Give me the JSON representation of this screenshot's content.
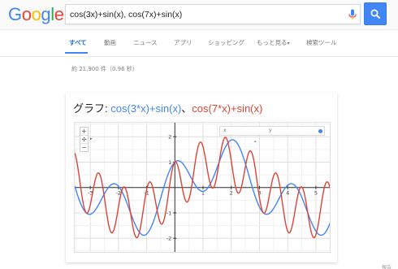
{
  "logo": {
    "letters": [
      "G",
      "o",
      "o",
      "g",
      "l",
      "e"
    ],
    "colors": [
      "#4285f4",
      "#ea4335",
      "#fbbc05",
      "#4285f4",
      "#34a853",
      "#ea4335"
    ]
  },
  "search": {
    "value": "cos(3x)+sin(x), cos(7x)+sin(x)",
    "mic_icon": "microphone-icon",
    "button_icon": "magnifier-icon",
    "accent": "#4285f4"
  },
  "tabs": [
    {
      "label": "すべて",
      "active": true
    },
    {
      "label": "動画",
      "active": false
    },
    {
      "label": "ニュース",
      "active": false
    },
    {
      "label": "アプリ",
      "active": false
    },
    {
      "label": "ショッピング",
      "active": false
    },
    {
      "label": "もっと見る",
      "active": false,
      "caret": "▾"
    },
    {
      "label": "検索ツール",
      "active": false
    }
  ],
  "result_stats": "約 21,900 件（0.96 秒）",
  "graph_card": {
    "label": "グラフ: ",
    "function1": "cos(3*x)+sin(x)",
    "separator": "、",
    "function2": "cos(7*x)+sin(x)",
    "coord_x_label": "x",
    "coord_y_label": "y",
    "zoom_in": "+",
    "zoom_out": "−",
    "pan": "✣"
  },
  "chart_data": {
    "type": "line",
    "title": "",
    "xlabel": "",
    "ylabel": "",
    "xlim": [
      -3.55,
      5.55
    ],
    "ylim": [
      -2.6,
      2.55
    ],
    "x_ticks": [
      -3,
      -2,
      -1,
      1,
      2,
      3,
      4,
      5
    ],
    "y_ticks": [
      -2,
      -1,
      1,
      2
    ],
    "grid": true,
    "series": [
      {
        "name": "cos(3*x)+sin(x)",
        "color": "#4285f4",
        "expression": "cos(3x)+sin(x)"
      },
      {
        "name": "cos(7*x)+sin(x)",
        "color": "#db4437",
        "expression": "cos(7x)+sin(x)"
      }
    ]
  },
  "feedback": "報告"
}
